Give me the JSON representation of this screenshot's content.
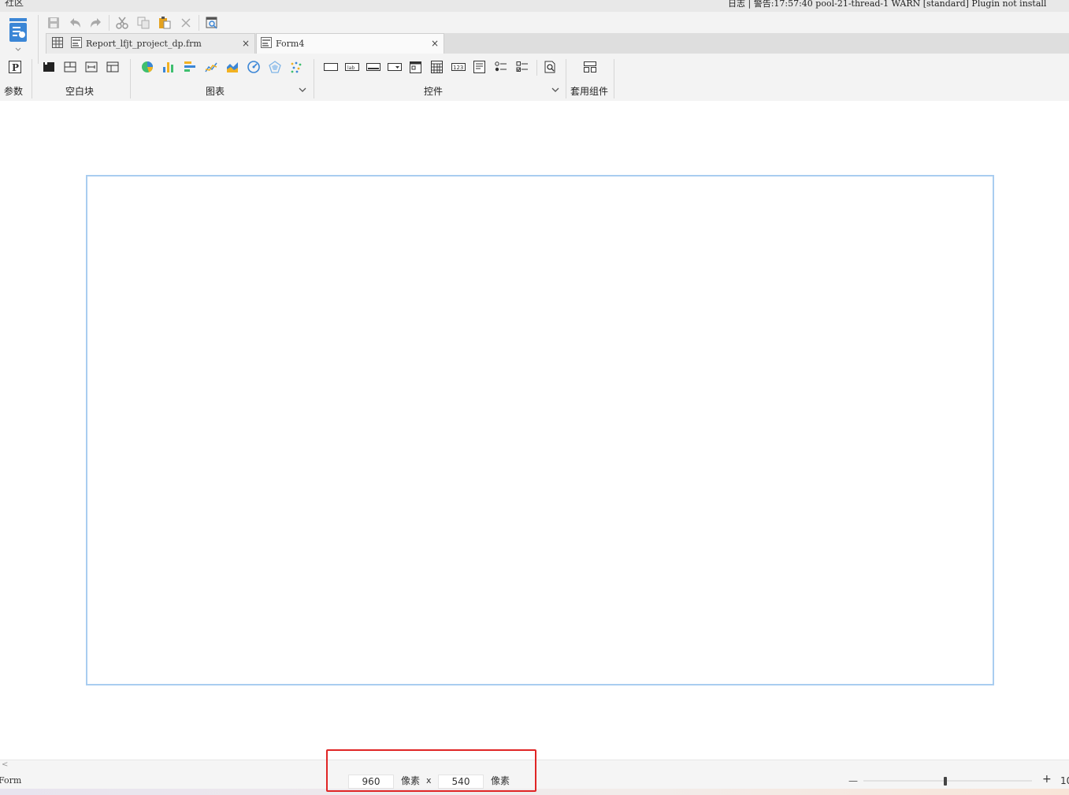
{
  "topbar": {
    "left_text": "社区",
    "right_text": "日志 | 警告:17:57:40 pool-21-thread-1 WARN [standard] Plugin not install"
  },
  "tabs": [
    {
      "label": "Report_lfjt_project_dp.frm",
      "close": "×"
    },
    {
      "label": "Form4",
      "close": "×"
    }
  ],
  "ribbon": {
    "param_label": "参数",
    "blank_label": "空白块",
    "chart_label": "图表",
    "control_label": "控件",
    "component_label": "套用组件"
  },
  "canvas": {
    "width_value": "960",
    "height_value": "540",
    "unit_label": "像素",
    "separator": "x"
  },
  "status": {
    "form_label": "Form",
    "zoom_minus": "—",
    "zoom_plus": "+",
    "zoom_value": "10",
    "scroll_arrow": "<"
  },
  "colors": {
    "accent": "#3b86d6",
    "canvas_border": "#a9cdf0",
    "highlight_box": "#e02525"
  }
}
